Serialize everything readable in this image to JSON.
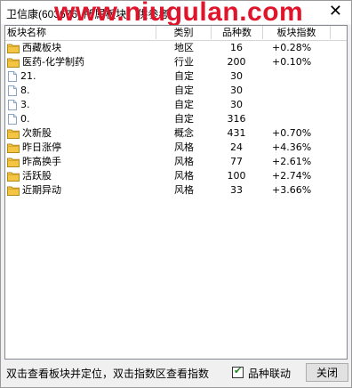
{
  "window": {
    "title": "卫信康(603676) 所属板块，供参考",
    "watermark": "www.niugulan.com"
  },
  "table": {
    "columns": [
      "板块名称",
      "类别",
      "品种数",
      "板块指数"
    ],
    "rows": [
      {
        "icon": "folder-icon",
        "name": "西藏板块",
        "type": "地区",
        "count": "16",
        "index": "+0.28%"
      },
      {
        "icon": "folder-icon",
        "name": "医药-化学制药",
        "type": "行业",
        "count": "200",
        "index": "+0.10%"
      },
      {
        "icon": "document-icon",
        "name": "21.",
        "type": "自定",
        "count": "30",
        "index": ""
      },
      {
        "icon": "document-icon",
        "name": "8.",
        "type": "自定",
        "count": "30",
        "index": ""
      },
      {
        "icon": "document-icon",
        "name": "3.",
        "type": "自定",
        "count": "30",
        "index": ""
      },
      {
        "icon": "document-icon",
        "name": "0.",
        "type": "自定",
        "count": "316",
        "index": ""
      },
      {
        "icon": "folder-icon",
        "name": "次新股",
        "type": "概念",
        "count": "431",
        "index": "+0.70%"
      },
      {
        "icon": "folder-icon",
        "name": "昨日涨停",
        "type": "风格",
        "count": "24",
        "index": "+4.36%"
      },
      {
        "icon": "folder-icon",
        "name": "昨高换手",
        "type": "风格",
        "count": "77",
        "index": "+2.61%"
      },
      {
        "icon": "folder-icon",
        "name": "活跃股",
        "type": "风格",
        "count": "100",
        "index": "+2.74%"
      },
      {
        "icon": "folder-icon",
        "name": "近期异动",
        "type": "风格",
        "count": "33",
        "index": "+3.66%"
      }
    ]
  },
  "footer": {
    "hint": "双击查看板块并定位，双击指数区查看指数",
    "checkbox_label": "品种联动",
    "checkbox_checked": true,
    "close_label": "关闭"
  },
  "colors": {
    "watermark": "#e0142a",
    "folder": "#f4c542",
    "check": "#1a8a1a"
  }
}
